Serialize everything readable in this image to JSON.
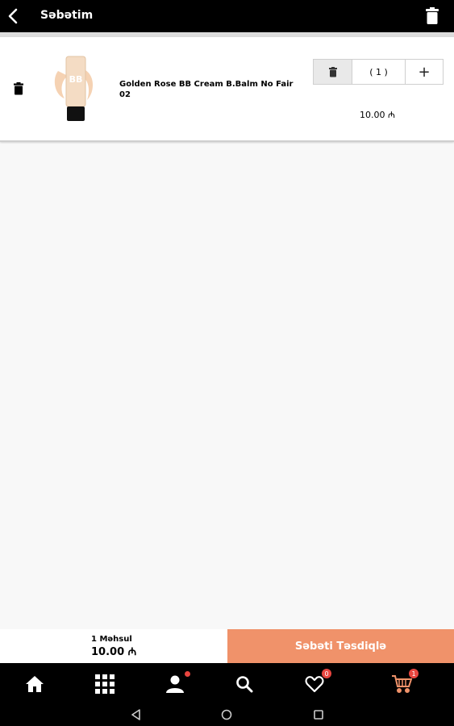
{
  "header": {
    "title": "Səbətim"
  },
  "cart": {
    "item": {
      "name": "Golden Rose  BB Cream B.Balm No Fair 02",
      "quantity": "( 1 )",
      "plus": "+",
      "price": "10.00 ₼"
    }
  },
  "summary": {
    "count": "1 Məhsul",
    "total": "10.00 ₼",
    "confirm_label": "Səbəti Təsdiqlə"
  },
  "bottom_nav": {
    "favorites_badge": "0",
    "cart_badge": "1"
  },
  "colors": {
    "accent": "#f0926a",
    "badge": "#e9453f"
  }
}
